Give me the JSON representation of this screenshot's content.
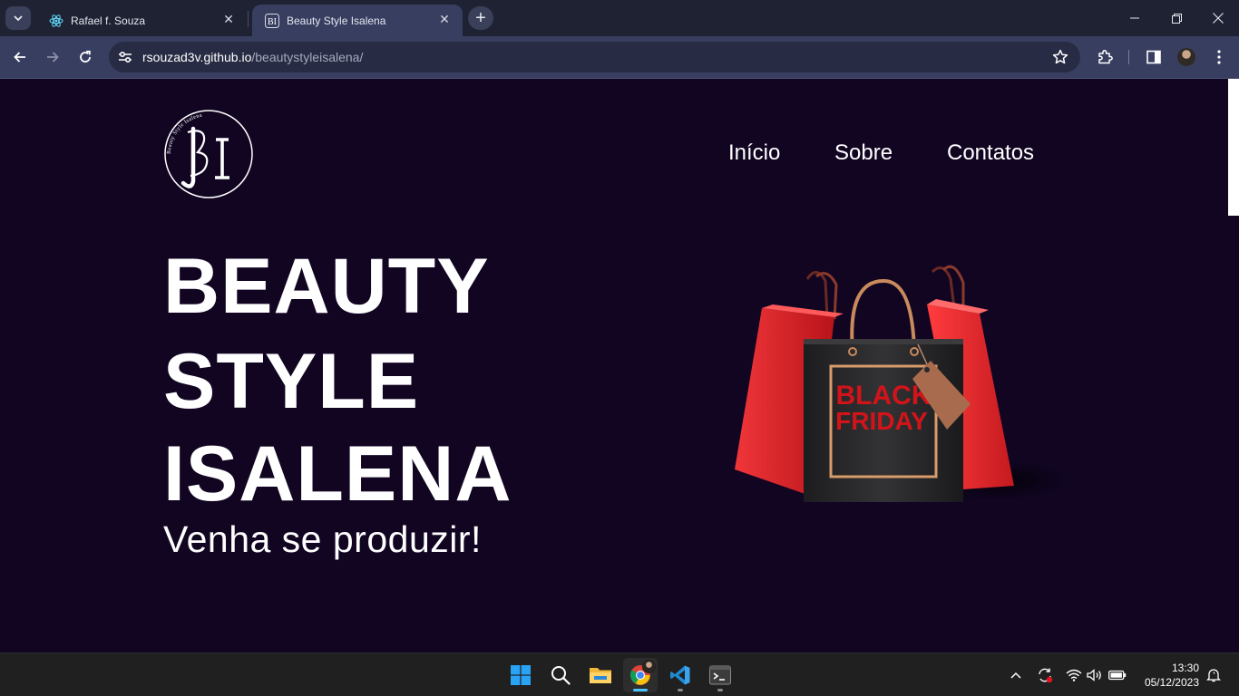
{
  "browser": {
    "tabs": [
      {
        "title": "Rafael f. Souza",
        "favicon": "react-icon",
        "active": false
      },
      {
        "title": "Beauty Style Isalena",
        "favicon": "bi-logo-icon",
        "active": true
      }
    ],
    "address": {
      "host": "rsouzad3v.github.io",
      "path": "/beautystyleisalena/"
    }
  },
  "site": {
    "logo_text": "Beauty Style Isalena",
    "logo_monogram": "BI",
    "nav": [
      {
        "label": "Início"
      },
      {
        "label": "Sobre"
      },
      {
        "label": "Contatos"
      }
    ],
    "hero": {
      "lines": [
        "BEAUTY",
        "STYLE",
        "ISALENA"
      ],
      "subtitle": "Venha se produzir!"
    },
    "promo_image": {
      "text_line1": "BLACK",
      "text_line2": "FRIDAY"
    }
  },
  "colors": {
    "page_bg": "#110522",
    "chrome_tabstrip": "#1f2233",
    "chrome_toolbar": "#383e60",
    "omnibox": "#272b43",
    "bag_red": "#e8262b",
    "bag_black": "#2a2a2c",
    "bf_text": "#d2141a",
    "taskbar": "#202020",
    "accent_running": "#4cc2ff"
  },
  "taskbar": {
    "apps": [
      {
        "name": "start-icon"
      },
      {
        "name": "search-icon"
      },
      {
        "name": "file-explorer-icon"
      },
      {
        "name": "chrome-icon"
      },
      {
        "name": "vscode-icon"
      },
      {
        "name": "terminal-icon"
      }
    ],
    "time": "13:30",
    "date": "05/12/2023"
  }
}
